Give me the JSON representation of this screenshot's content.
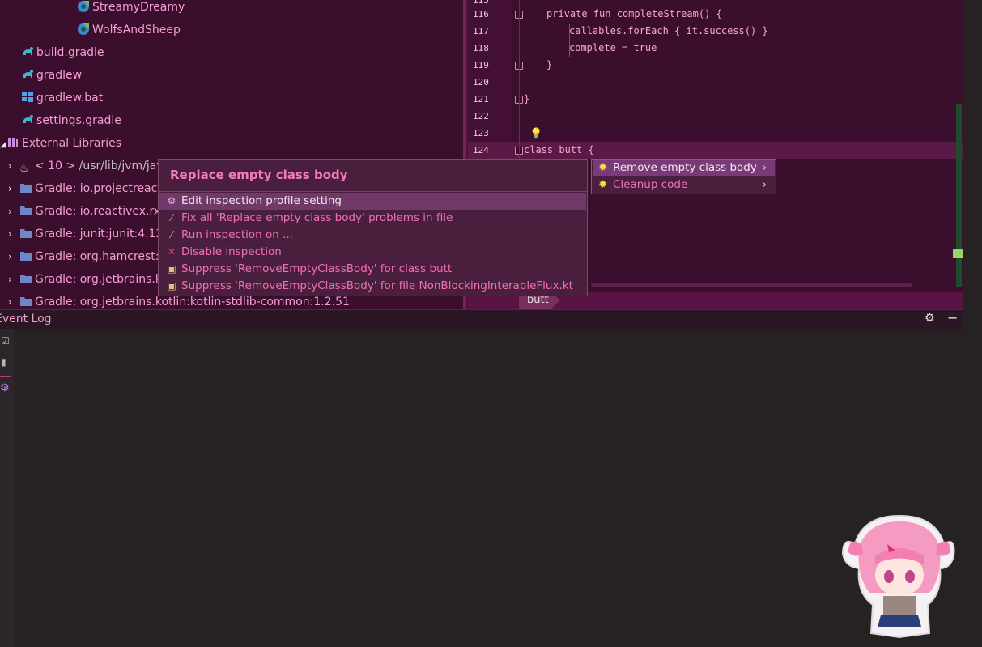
{
  "tree": {
    "items": [
      {
        "label": "StreamyDreamy",
        "icon": "kotlin-file-icon"
      },
      {
        "label": "WolfsAndSheep",
        "icon": "kotlin-file-icon"
      },
      {
        "label": "build.gradle",
        "icon": "gradle-icon"
      },
      {
        "label": "gradlew",
        "icon": "gradle-icon"
      },
      {
        "label": "gradlew.bat",
        "icon": "windows-icon"
      },
      {
        "label": "settings.gradle",
        "icon": "gradle-icon"
      },
      {
        "label": "External Libraries",
        "icon": "library-icon"
      },
      {
        "label": "< 10 >",
        "path": "/usr/lib/jvm/jav",
        "icon": "jdk-icon"
      },
      {
        "label": "Gradle: io.projectreact",
        "icon": "folder-icon"
      },
      {
        "label": "Gradle: io.reactivex.rx",
        "icon": "folder-icon"
      },
      {
        "label": "Gradle: junit:junit:4.12",
        "icon": "folder-icon"
      },
      {
        "label": "Gradle: org.hamcrest:h",
        "icon": "folder-icon"
      },
      {
        "label": "Gradle: org.jetbrains.k",
        "icon": "folder-icon"
      },
      {
        "label": "Gradle: org.jetbrains.kotlin:kotlin-stdlib-common:1.2.51",
        "icon": "folder-icon"
      }
    ]
  },
  "editor": {
    "lines": [
      {
        "num": "116",
        "text": "private fun completeStream() {"
      },
      {
        "num": "117",
        "text": "callables.forEach { it.success() }"
      },
      {
        "num": "118",
        "text": "complete = true"
      },
      {
        "num": "119",
        "text": "}"
      },
      {
        "num": "120",
        "text": ""
      },
      {
        "num": "121",
        "text": "}"
      },
      {
        "num": "122",
        "text": ""
      },
      {
        "num": "123",
        "text": ""
      },
      {
        "num": "124",
        "text": "class butt {"
      }
    ],
    "breadcrumb": "butt"
  },
  "popup": {
    "title": "Replace empty class body",
    "items": [
      {
        "label": "Edit inspection profile setting",
        "icon": "gear-icon"
      },
      {
        "label": "Fix all 'Replace empty class body' problems in file",
        "icon": "magic-wand-icon"
      },
      {
        "label": "Run inspection on ...",
        "icon": "magic-wand-icon"
      },
      {
        "label": "Disable inspection",
        "icon": "close-icon"
      },
      {
        "label": "Suppress 'RemoveEmptyClassBody' for class butt",
        "icon": "suppress-icon"
      },
      {
        "label": "Suppress 'RemoveEmptyClassBody' for file NonBlockingInterableFlux.kt",
        "icon": "suppress-icon"
      }
    ]
  },
  "submenu": {
    "items": [
      {
        "label": "Remove empty class body",
        "icon": "bulb-icon"
      },
      {
        "label": "Cleanup code",
        "icon": "bulb-icon"
      }
    ]
  },
  "event_log": {
    "title": "Event Log"
  },
  "colors": {
    "tree_bg": "#3a0e2c",
    "editor_bg": "#3c0e2e",
    "accent_pink": "#f070b4",
    "popup_bg": "#4a1f3d"
  }
}
